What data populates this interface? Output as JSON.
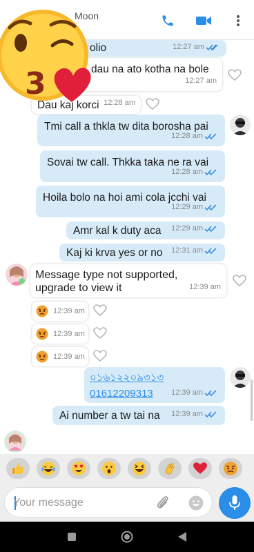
{
  "header": {
    "contact_name": "Moon",
    "icons": [
      "phone-icon",
      "video-call-icon",
      "more-options-icon"
    ]
  },
  "colors": {
    "outgoing_bubble": "#d6eaf8",
    "incoming_bubble": "#ffffff",
    "accent": "#2a8ee8",
    "tick": "#3c8fe0"
  },
  "messages": [
    {
      "dir": "out",
      "text": "olio",
      "time": "12:27 am"
    },
    {
      "dir": "in",
      "text": "dau na ato kotha na bole",
      "time": "12:27 am"
    },
    {
      "dir": "in",
      "text": "Dau kaj korci",
      "time": "12:28 am"
    },
    {
      "dir": "out",
      "text": "Tmi call a thkla tw dita borosha pai",
      "time": "12:28 am"
    },
    {
      "dir": "out",
      "text": "Sovai tw call. Thkka taka ne ra vai",
      "time": "12:28 am"
    },
    {
      "dir": "out",
      "text": "Hoila bolo na hoi ami cola jcchi vai",
      "time": "12:29 am"
    },
    {
      "dir": "out",
      "text": "Amr kal k duty aca",
      "time": "12:29 am"
    },
    {
      "dir": "out",
      "text": "Kaj ki krva yes or no",
      "time": "12:31 am"
    },
    {
      "dir": "in",
      "text_line1": "Message type not supported,",
      "text_line2": "upgrade to view it",
      "time": "12:39 am"
    },
    {
      "dir": "in",
      "emoji": "angry-face",
      "time": "12:39 am"
    },
    {
      "dir": "in",
      "emoji": "angry-face",
      "time": "12:39 am"
    },
    {
      "dir": "in",
      "emoji": "angry-face",
      "time": "12:39 am"
    },
    {
      "dir": "out",
      "text_line1": "০১৬১২২০৯৩১৩",
      "text_line2": "01612209313",
      "time": "12:39 am"
    },
    {
      "dir": "out",
      "text": "Ai number a tw tai na",
      "time": "12:39 am"
    }
  ],
  "reactions": [
    "thumbs-up",
    "laughing-tears",
    "heart-eyes",
    "surprised",
    "grinning-squint",
    "clapping",
    "red-heart",
    "angry"
  ],
  "input": {
    "placeholder": "Your message"
  },
  "nav": [
    "recent-apps-icon",
    "home-icon",
    "back-icon"
  ]
}
